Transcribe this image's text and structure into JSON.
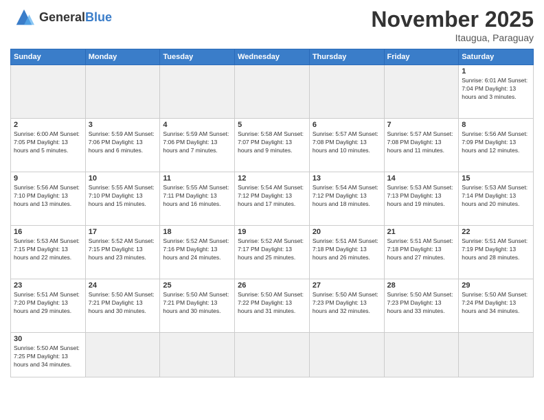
{
  "header": {
    "logo_general": "General",
    "logo_blue": "Blue",
    "month_title": "November 2025",
    "location": "Itaugua, Paraguay"
  },
  "days_of_week": [
    "Sunday",
    "Monday",
    "Tuesday",
    "Wednesday",
    "Thursday",
    "Friday",
    "Saturday"
  ],
  "weeks": [
    [
      {
        "day": "",
        "info": "",
        "empty": true
      },
      {
        "day": "",
        "info": "",
        "empty": true
      },
      {
        "day": "",
        "info": "",
        "empty": true
      },
      {
        "day": "",
        "info": "",
        "empty": true
      },
      {
        "day": "",
        "info": "",
        "empty": true
      },
      {
        "day": "",
        "info": "",
        "empty": true
      },
      {
        "day": "1",
        "info": "Sunrise: 6:01 AM\nSunset: 7:04 PM\nDaylight: 13 hours and 3 minutes."
      }
    ],
    [
      {
        "day": "2",
        "info": "Sunrise: 6:00 AM\nSunset: 7:05 PM\nDaylight: 13 hours and 5 minutes."
      },
      {
        "day": "3",
        "info": "Sunrise: 5:59 AM\nSunset: 7:06 PM\nDaylight: 13 hours and 6 minutes."
      },
      {
        "day": "4",
        "info": "Sunrise: 5:59 AM\nSunset: 7:06 PM\nDaylight: 13 hours and 7 minutes."
      },
      {
        "day": "5",
        "info": "Sunrise: 5:58 AM\nSunset: 7:07 PM\nDaylight: 13 hours and 9 minutes."
      },
      {
        "day": "6",
        "info": "Sunrise: 5:57 AM\nSunset: 7:08 PM\nDaylight: 13 hours and 10 minutes."
      },
      {
        "day": "7",
        "info": "Sunrise: 5:57 AM\nSunset: 7:08 PM\nDaylight: 13 hours and 11 minutes."
      },
      {
        "day": "8",
        "info": "Sunrise: 5:56 AM\nSunset: 7:09 PM\nDaylight: 13 hours and 12 minutes."
      }
    ],
    [
      {
        "day": "9",
        "info": "Sunrise: 5:56 AM\nSunset: 7:10 PM\nDaylight: 13 hours and 13 minutes."
      },
      {
        "day": "10",
        "info": "Sunrise: 5:55 AM\nSunset: 7:10 PM\nDaylight: 13 hours and 15 minutes."
      },
      {
        "day": "11",
        "info": "Sunrise: 5:55 AM\nSunset: 7:11 PM\nDaylight: 13 hours and 16 minutes."
      },
      {
        "day": "12",
        "info": "Sunrise: 5:54 AM\nSunset: 7:12 PM\nDaylight: 13 hours and 17 minutes."
      },
      {
        "day": "13",
        "info": "Sunrise: 5:54 AM\nSunset: 7:12 PM\nDaylight: 13 hours and 18 minutes."
      },
      {
        "day": "14",
        "info": "Sunrise: 5:53 AM\nSunset: 7:13 PM\nDaylight: 13 hours and 19 minutes."
      },
      {
        "day": "15",
        "info": "Sunrise: 5:53 AM\nSunset: 7:14 PM\nDaylight: 13 hours and 20 minutes."
      }
    ],
    [
      {
        "day": "16",
        "info": "Sunrise: 5:53 AM\nSunset: 7:15 PM\nDaylight: 13 hours and 22 minutes."
      },
      {
        "day": "17",
        "info": "Sunrise: 5:52 AM\nSunset: 7:15 PM\nDaylight: 13 hours and 23 minutes."
      },
      {
        "day": "18",
        "info": "Sunrise: 5:52 AM\nSunset: 7:16 PM\nDaylight: 13 hours and 24 minutes."
      },
      {
        "day": "19",
        "info": "Sunrise: 5:52 AM\nSunset: 7:17 PM\nDaylight: 13 hours and 25 minutes."
      },
      {
        "day": "20",
        "info": "Sunrise: 5:51 AM\nSunset: 7:18 PM\nDaylight: 13 hours and 26 minutes."
      },
      {
        "day": "21",
        "info": "Sunrise: 5:51 AM\nSunset: 7:18 PM\nDaylight: 13 hours and 27 minutes."
      },
      {
        "day": "22",
        "info": "Sunrise: 5:51 AM\nSunset: 7:19 PM\nDaylight: 13 hours and 28 minutes."
      }
    ],
    [
      {
        "day": "23",
        "info": "Sunrise: 5:51 AM\nSunset: 7:20 PM\nDaylight: 13 hours and 29 minutes."
      },
      {
        "day": "24",
        "info": "Sunrise: 5:50 AM\nSunset: 7:21 PM\nDaylight: 13 hours and 30 minutes."
      },
      {
        "day": "25",
        "info": "Sunrise: 5:50 AM\nSunset: 7:21 PM\nDaylight: 13 hours and 30 minutes."
      },
      {
        "day": "26",
        "info": "Sunrise: 5:50 AM\nSunset: 7:22 PM\nDaylight: 13 hours and 31 minutes."
      },
      {
        "day": "27",
        "info": "Sunrise: 5:50 AM\nSunset: 7:23 PM\nDaylight: 13 hours and 32 minutes."
      },
      {
        "day": "28",
        "info": "Sunrise: 5:50 AM\nSunset: 7:23 PM\nDaylight: 13 hours and 33 minutes."
      },
      {
        "day": "29",
        "info": "Sunrise: 5:50 AM\nSunset: 7:24 PM\nDaylight: 13 hours and 34 minutes."
      }
    ],
    [
      {
        "day": "30",
        "info": "Sunrise: 5:50 AM\nSunset: 7:25 PM\nDaylight: 13 hours and 34 minutes.",
        "last": true
      },
      {
        "day": "",
        "info": "",
        "empty": true,
        "last": true
      },
      {
        "day": "",
        "info": "",
        "empty": true,
        "last": true
      },
      {
        "day": "",
        "info": "",
        "empty": true,
        "last": true
      },
      {
        "day": "",
        "info": "",
        "empty": true,
        "last": true
      },
      {
        "day": "",
        "info": "",
        "empty": true,
        "last": true
      },
      {
        "day": "",
        "info": "",
        "empty": true,
        "last": true
      }
    ]
  ]
}
